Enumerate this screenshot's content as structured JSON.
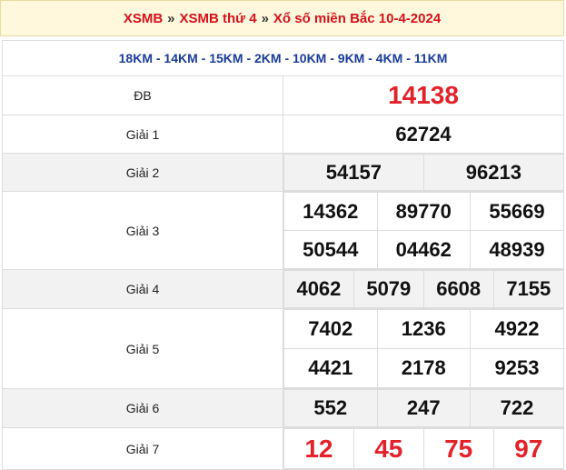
{
  "header": {
    "crumb1": "XSMB",
    "sep1": "»",
    "crumb2": "XSMB thứ 4",
    "sep2": "»",
    "crumb3": "Xổ số miền Bắc 10-4-2024"
  },
  "codes": "18KM - 14KM - 15KM - 2KM - 10KM - 9KM - 4KM - 11KM",
  "rows": {
    "db": {
      "label": "ĐB",
      "values": [
        "14138"
      ]
    },
    "g1": {
      "label": "Giải 1",
      "values": [
        "62724"
      ]
    },
    "g2": {
      "label": "Giải 2",
      "values": [
        "54157",
        "96213"
      ]
    },
    "g3": {
      "label": "Giải 3",
      "values": [
        "14362",
        "89770",
        "55669",
        "50544",
        "04462",
        "48939"
      ]
    },
    "g4": {
      "label": "Giải 4",
      "values": [
        "4062",
        "5079",
        "6608",
        "7155"
      ]
    },
    "g5": {
      "label": "Giải 5",
      "values": [
        "7402",
        "1236",
        "4922",
        "4421",
        "2178",
        "9253"
      ]
    },
    "g6": {
      "label": "Giải 6",
      "values": [
        "552",
        "247",
        "722"
      ]
    },
    "g7": {
      "label": "Giải 7",
      "values": [
        "12",
        "45",
        "75",
        "97"
      ]
    }
  },
  "colors": {
    "accent_red": "#e3212a",
    "code_blue": "#1a3b9a",
    "header_bg": "#fff8dc"
  }
}
